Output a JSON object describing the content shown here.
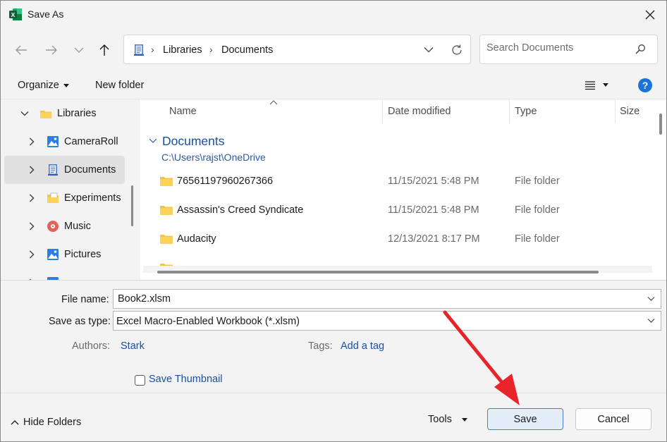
{
  "window": {
    "title": "Save As",
    "app_icon": "excel-icon",
    "close_label": "✕"
  },
  "navbar": {
    "back_icon": "arrow-left-icon",
    "forward_icon": "arrow-right-icon",
    "recent_icon": "chevron-down-icon",
    "up_icon": "arrow-up-icon",
    "breadcrumb": [
      "Libraries",
      "Documents"
    ],
    "search_placeholder": "Search Documents"
  },
  "toolbar": {
    "organize": "Organize",
    "new_folder": "New folder",
    "help": "?"
  },
  "sidebar": {
    "items": [
      {
        "label": "Libraries",
        "icon": "folder-icon",
        "level": 0,
        "expanded": true,
        "selected": false
      },
      {
        "label": "CameraRoll",
        "icon": "camera-roll-icon",
        "level": 1,
        "expanded": false,
        "selected": false
      },
      {
        "label": "Documents",
        "icon": "documents-icon",
        "level": 1,
        "expanded": false,
        "selected": true
      },
      {
        "label": "Experiments",
        "icon": "folder-doc-icon",
        "level": 1,
        "expanded": false,
        "selected": false
      },
      {
        "label": "Music",
        "icon": "music-icon",
        "level": 1,
        "expanded": false,
        "selected": false
      },
      {
        "label": "Pictures",
        "icon": "pictures-icon",
        "level": 1,
        "expanded": false,
        "selected": false
      }
    ]
  },
  "files": {
    "columns": [
      "Name",
      "Date modified",
      "Type",
      "Size"
    ],
    "group_title": "Documents",
    "group_path": "C:\\Users\\rajst\\OneDrive",
    "rows": [
      {
        "name": "76561197960267366",
        "date": "11/15/2021 5:48 PM",
        "type": "File folder"
      },
      {
        "name": "Assassin's Creed Syndicate",
        "date": "11/15/2021 5:48 PM",
        "type": "File folder"
      },
      {
        "name": "Audacity",
        "date": "12/13/2021 8:17 PM",
        "type": "File folder"
      }
    ]
  },
  "form": {
    "file_name_label": "File name:",
    "file_name_value": "Book2.xlsm",
    "save_type_label": "Save as type:",
    "save_type_value": "Excel Macro-Enabled Workbook (*.xlsm)",
    "authors_label": "Authors:",
    "authors_value": "Stark",
    "tags_label": "Tags:",
    "tags_value": "Add a tag",
    "thumbnail_label": "Save Thumbnail",
    "thumbnail_checked": false
  },
  "bottom": {
    "hide_folders": "Hide Folders",
    "tools": "Tools",
    "save": "Save",
    "cancel": "Cancel"
  },
  "colors": {
    "accent": "#1a73d9",
    "link": "#1a4fa0",
    "annotation_arrow": "#e8232a",
    "folder": "#f6c443"
  }
}
